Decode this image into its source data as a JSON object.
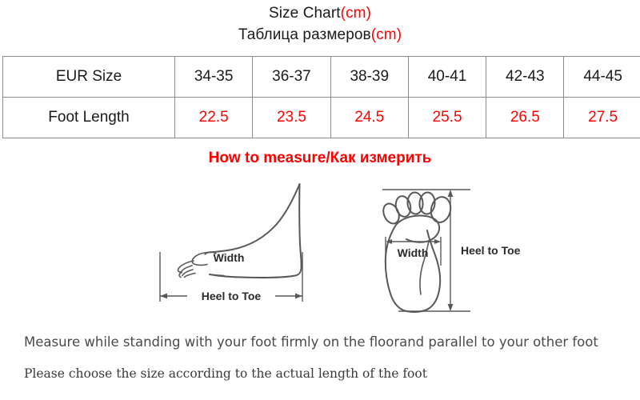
{
  "titles": {
    "en_main": "Size Chart",
    "en_unit": "(cm)",
    "ru_main": "Таблица размеров",
    "ru_unit": "(cm)"
  },
  "colors": {
    "accent_red": "#ff0000",
    "table_border": "#8c8c8c",
    "text": "#1a1a1a",
    "diagram_stroke": "#58585a"
  },
  "table": {
    "rows": [
      {
        "label": "EUR Size",
        "values": [
          "34-35",
          "36-37",
          "38-39",
          "40-41",
          "42-43",
          "44-45"
        ]
      },
      {
        "label": "Foot Length",
        "values": [
          "22.5",
          "23.5",
          "24.5",
          "25.5",
          "26.5",
          "27.5"
        ]
      }
    ]
  },
  "how_to_measure": {
    "heading": "How to measure/Как измерить"
  },
  "diagrams": {
    "side_view": {
      "width_label": "Width",
      "length_label": "Heel to Toe"
    },
    "sole_view": {
      "width_label": "Width",
      "length_label": "Heel to Toe"
    }
  },
  "notes": {
    "line1": "Measure while standing with your foot firmly on the floorand parallel to your other foot",
    "line2": "Please choose the size according to the actual length of the foot"
  }
}
